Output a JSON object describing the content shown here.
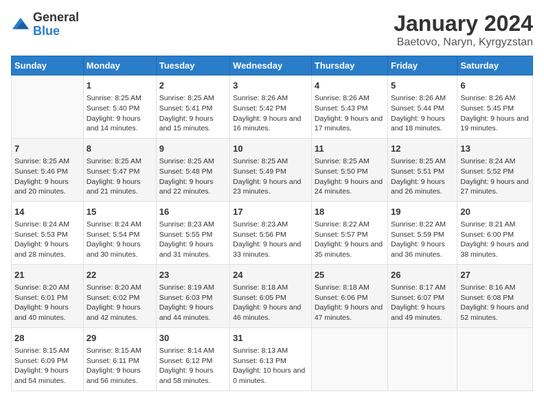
{
  "header": {
    "logo_general": "General",
    "logo_blue": "Blue",
    "main_title": "January 2024",
    "subtitle": "Baetovo, Naryn, Kyrgyzstan"
  },
  "calendar": {
    "days_of_week": [
      "Sunday",
      "Monday",
      "Tuesday",
      "Wednesday",
      "Thursday",
      "Friday",
      "Saturday"
    ],
    "rows": [
      [
        {
          "day": "",
          "sunrise": "",
          "sunset": "",
          "daylight": ""
        },
        {
          "day": "1",
          "sunrise": "Sunrise: 8:25 AM",
          "sunset": "Sunset: 5:40 PM",
          "daylight": "Daylight: 9 hours and 14 minutes."
        },
        {
          "day": "2",
          "sunrise": "Sunrise: 8:25 AM",
          "sunset": "Sunset: 5:41 PM",
          "daylight": "Daylight: 9 hours and 15 minutes."
        },
        {
          "day": "3",
          "sunrise": "Sunrise: 8:26 AM",
          "sunset": "Sunset: 5:42 PM",
          "daylight": "Daylight: 9 hours and 16 minutes."
        },
        {
          "day": "4",
          "sunrise": "Sunrise: 8:26 AM",
          "sunset": "Sunset: 5:43 PM",
          "daylight": "Daylight: 9 hours and 17 minutes."
        },
        {
          "day": "5",
          "sunrise": "Sunrise: 8:26 AM",
          "sunset": "Sunset: 5:44 PM",
          "daylight": "Daylight: 9 hours and 18 minutes."
        },
        {
          "day": "6",
          "sunrise": "Sunrise: 8:26 AM",
          "sunset": "Sunset: 5:45 PM",
          "daylight": "Daylight: 9 hours and 19 minutes."
        }
      ],
      [
        {
          "day": "7",
          "sunrise": "Sunrise: 8:25 AM",
          "sunset": "Sunset: 5:46 PM",
          "daylight": "Daylight: 9 hours and 20 minutes."
        },
        {
          "day": "8",
          "sunrise": "Sunrise: 8:25 AM",
          "sunset": "Sunset: 5:47 PM",
          "daylight": "Daylight: 9 hours and 21 minutes."
        },
        {
          "day": "9",
          "sunrise": "Sunrise: 8:25 AM",
          "sunset": "Sunset: 5:48 PM",
          "daylight": "Daylight: 9 hours and 22 minutes."
        },
        {
          "day": "10",
          "sunrise": "Sunrise: 8:25 AM",
          "sunset": "Sunset: 5:49 PM",
          "daylight": "Daylight: 9 hours and 23 minutes."
        },
        {
          "day": "11",
          "sunrise": "Sunrise: 8:25 AM",
          "sunset": "Sunset: 5:50 PM",
          "daylight": "Daylight: 9 hours and 24 minutes."
        },
        {
          "day": "12",
          "sunrise": "Sunrise: 8:25 AM",
          "sunset": "Sunset: 5:51 PM",
          "daylight": "Daylight: 9 hours and 26 minutes."
        },
        {
          "day": "13",
          "sunrise": "Sunrise: 8:24 AM",
          "sunset": "Sunset: 5:52 PM",
          "daylight": "Daylight: 9 hours and 27 minutes."
        }
      ],
      [
        {
          "day": "14",
          "sunrise": "Sunrise: 8:24 AM",
          "sunset": "Sunset: 5:53 PM",
          "daylight": "Daylight: 9 hours and 28 minutes."
        },
        {
          "day": "15",
          "sunrise": "Sunrise: 8:24 AM",
          "sunset": "Sunset: 5:54 PM",
          "daylight": "Daylight: 9 hours and 30 minutes."
        },
        {
          "day": "16",
          "sunrise": "Sunrise: 8:23 AM",
          "sunset": "Sunset: 5:55 PM",
          "daylight": "Daylight: 9 hours and 31 minutes."
        },
        {
          "day": "17",
          "sunrise": "Sunrise: 8:23 AM",
          "sunset": "Sunset: 5:56 PM",
          "daylight": "Daylight: 9 hours and 33 minutes."
        },
        {
          "day": "18",
          "sunrise": "Sunrise: 8:22 AM",
          "sunset": "Sunset: 5:57 PM",
          "daylight": "Daylight: 9 hours and 35 minutes."
        },
        {
          "day": "19",
          "sunrise": "Sunrise: 8:22 AM",
          "sunset": "Sunset: 5:59 PM",
          "daylight": "Daylight: 9 hours and 36 minutes."
        },
        {
          "day": "20",
          "sunrise": "Sunrise: 8:21 AM",
          "sunset": "Sunset: 6:00 PM",
          "daylight": "Daylight: 9 hours and 38 minutes."
        }
      ],
      [
        {
          "day": "21",
          "sunrise": "Sunrise: 8:20 AM",
          "sunset": "Sunset: 6:01 PM",
          "daylight": "Daylight: 9 hours and 40 minutes."
        },
        {
          "day": "22",
          "sunrise": "Sunrise: 8:20 AM",
          "sunset": "Sunset: 6:02 PM",
          "daylight": "Daylight: 9 hours and 42 minutes."
        },
        {
          "day": "23",
          "sunrise": "Sunrise: 8:19 AM",
          "sunset": "Sunset: 6:03 PM",
          "daylight": "Daylight: 9 hours and 44 minutes."
        },
        {
          "day": "24",
          "sunrise": "Sunrise: 8:18 AM",
          "sunset": "Sunset: 6:05 PM",
          "daylight": "Daylight: 9 hours and 46 minutes."
        },
        {
          "day": "25",
          "sunrise": "Sunrise: 8:18 AM",
          "sunset": "Sunset: 6:06 PM",
          "daylight": "Daylight: 9 hours and 47 minutes."
        },
        {
          "day": "26",
          "sunrise": "Sunrise: 8:17 AM",
          "sunset": "Sunset: 6:07 PM",
          "daylight": "Daylight: 9 hours and 49 minutes."
        },
        {
          "day": "27",
          "sunrise": "Sunrise: 8:16 AM",
          "sunset": "Sunset: 6:08 PM",
          "daylight": "Daylight: 9 hours and 52 minutes."
        }
      ],
      [
        {
          "day": "28",
          "sunrise": "Sunrise: 8:15 AM",
          "sunset": "Sunset: 6:09 PM",
          "daylight": "Daylight: 9 hours and 54 minutes."
        },
        {
          "day": "29",
          "sunrise": "Sunrise: 8:15 AM",
          "sunset": "Sunset: 6:11 PM",
          "daylight": "Daylight: 9 hours and 56 minutes."
        },
        {
          "day": "30",
          "sunrise": "Sunrise: 8:14 AM",
          "sunset": "Sunset: 6:12 PM",
          "daylight": "Daylight: 9 hours and 58 minutes."
        },
        {
          "day": "31",
          "sunrise": "Sunrise: 8:13 AM",
          "sunset": "Sunset: 6:13 PM",
          "daylight": "Daylight: 10 hours and 0 minutes."
        },
        {
          "day": "",
          "sunrise": "",
          "sunset": "",
          "daylight": ""
        },
        {
          "day": "",
          "sunrise": "",
          "sunset": "",
          "daylight": ""
        },
        {
          "day": "",
          "sunrise": "",
          "sunset": "",
          "daylight": ""
        }
      ]
    ]
  }
}
